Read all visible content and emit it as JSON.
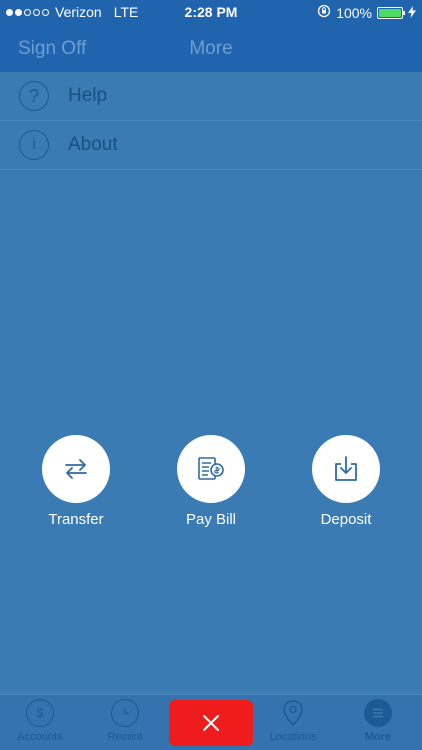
{
  "status": {
    "carrier": "Verizon",
    "network": "LTE",
    "time": "2:28 PM",
    "battery": "100%"
  },
  "nav": {
    "left_button": "Sign Off",
    "title": "More"
  },
  "menu": [
    {
      "label": "Help",
      "icon": "question-icon"
    },
    {
      "label": "About",
      "icon": "info-icon"
    }
  ],
  "actions": [
    {
      "label": "Transfer",
      "icon": "transfer-icon"
    },
    {
      "label": "Pay Bill",
      "icon": "bill-icon"
    },
    {
      "label": "Deposit",
      "icon": "deposit-icon"
    }
  ],
  "tabs": [
    {
      "label": "Accounts"
    },
    {
      "label": "Recent"
    },
    {
      "label": "Locations"
    },
    {
      "label": "More"
    }
  ],
  "colors": {
    "primary": "#1f64ad",
    "background": "#3a7bb3",
    "close": "#ee1c1c"
  }
}
